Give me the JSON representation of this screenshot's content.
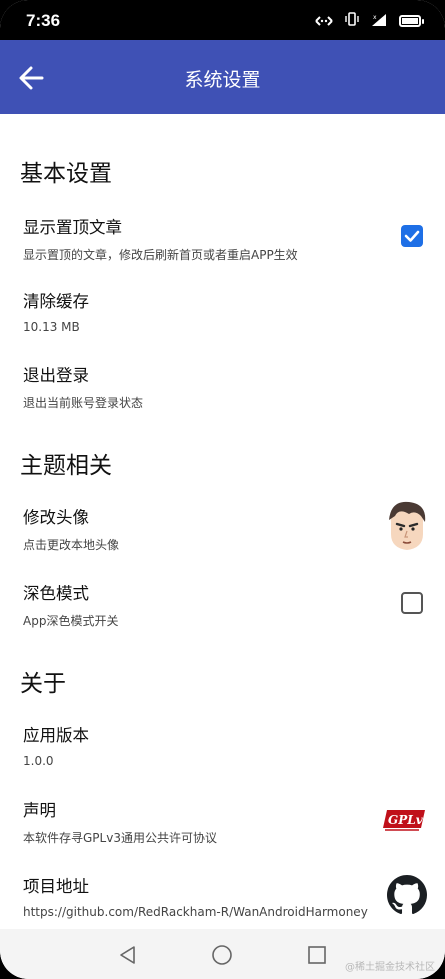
{
  "status_bar": {
    "time": "7:36",
    "icons": [
      "data-transfer-icon",
      "vibrate-icon",
      "signal-icon",
      "battery-icon"
    ]
  },
  "app_bar": {
    "title": "系统设置",
    "back_icon": "arrow-left-icon",
    "color": "#3F51B5"
  },
  "sections": {
    "basic": {
      "title": "基本设置",
      "show_top": {
        "title": "显示置顶文章",
        "subtitle": "显示置顶的文章，修改后刷新首页或者重启APP生效",
        "checked": true
      },
      "clear_cache": {
        "title": "清除缓存",
        "subtitle": "10.13 MB"
      },
      "logout": {
        "title": "退出登录",
        "subtitle": "退出当前账号登录状态"
      }
    },
    "theme": {
      "title": "主题相关",
      "avatar": {
        "title": "修改头像",
        "subtitle": "点击更改本地头像"
      },
      "dark_mode": {
        "title": "深色模式",
        "subtitle": "App深色模式开关",
        "checked": false
      }
    },
    "about": {
      "title": "关于",
      "version": {
        "title": "应用版本",
        "subtitle": "1.0.0"
      },
      "statement": {
        "title": "声明",
        "subtitle": "本软件存寻GPLv3通用公共许可协议",
        "logo_text": "GPLv3"
      },
      "project": {
        "title": "项目地址",
        "subtitle": "https://github.com/RedRackham-R/WanAndroidHarmoney"
      }
    }
  },
  "nav_bar": {
    "buttons": [
      "back-triangle-icon",
      "home-circle-icon",
      "recents-square-icon"
    ]
  },
  "watermark": "@稀土掘金技术社区",
  "colors": {
    "checkbox_checked": "#1E6FE6",
    "appbar": "#3F51B5"
  }
}
